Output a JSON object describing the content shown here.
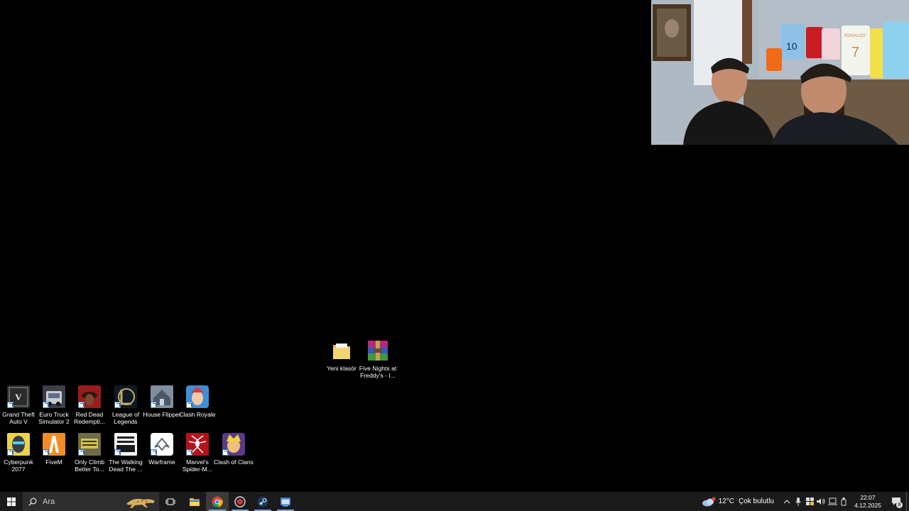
{
  "desktop": {
    "icons": [
      {
        "label": "Yeni klasör",
        "icon": "folder-icon"
      },
      {
        "label": "Five Nights at Freddy's - I...",
        "icon": "winrar-archive-icon"
      },
      {
        "label": "Grand Theft Auto V",
        "icon": "gta-v-icon"
      },
      {
        "label": "Euro Truck Simulator 2",
        "icon": "euro-truck-icon"
      },
      {
        "label": "Red Dead Redempti...",
        "icon": "red-dead-icon"
      },
      {
        "label": "League of Legends",
        "icon": "league-of-legends-icon"
      },
      {
        "label": "House Flipper",
        "icon": "house-flipper-icon"
      },
      {
        "label": "Clash Royale",
        "icon": "clash-royale-icon"
      },
      {
        "label": "Cyberpunk 2077",
        "icon": "cyberpunk-icon"
      },
      {
        "label": "FiveM",
        "icon": "fivem-icon"
      },
      {
        "label": "Only Climb Better To...",
        "icon": "only-climb-icon"
      },
      {
        "label": "The Walking Dead The ...",
        "icon": "walking-dead-icon"
      },
      {
        "label": "Warframe",
        "icon": "warframe-icon"
      },
      {
        "label": "Marvel's Spider-M...",
        "icon": "spiderman-icon"
      },
      {
        "label": "Clash of Clans",
        "icon": "clash-of-clans-icon"
      }
    ]
  },
  "taskbar": {
    "search_placeholder": "Ara",
    "weather": {
      "temp": "12°C",
      "condition": "Çok bulutlu"
    },
    "clock": {
      "time": "22:07",
      "date": "4.12.2025"
    },
    "notification_count": "8",
    "apps": [
      "task-view-icon",
      "file-explorer-icon",
      "chrome-icon",
      "app-red-icon",
      "steam-icon",
      "app-window-icon"
    ]
  },
  "webcam": {
    "jersey_numbers": [
      "10",
      "7"
    ],
    "jersey_name": "RONALDO"
  },
  "colors": {
    "taskbar": "#1b1b1b",
    "desktop": "#000000",
    "accent": "#7aa7d8"
  }
}
